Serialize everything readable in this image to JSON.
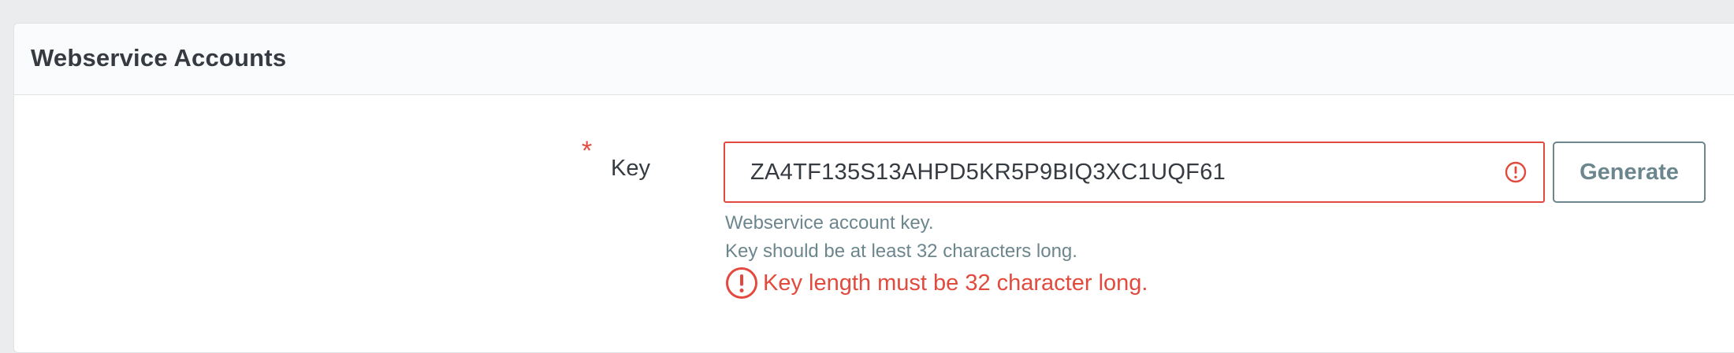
{
  "card": {
    "title": "Webservice Accounts"
  },
  "key_field": {
    "required_marker": "*",
    "label": "Key",
    "value": "ZA4TF135S13AHPD5KR5P9BIQ3XC1UQF61",
    "generate_label": "Generate",
    "help_lines": [
      "Webservice account key.",
      "Key should be at least 32 characters long."
    ],
    "error_message": "Key length must be 32 character long."
  },
  "colors": {
    "error": "#e14a3d",
    "muted": "#6c868e",
    "text": "#363a41",
    "page_bg": "#ebecee"
  },
  "icons": {
    "input_error": "exclamation-circle-icon",
    "error_message": "exclamation-circle-icon"
  }
}
